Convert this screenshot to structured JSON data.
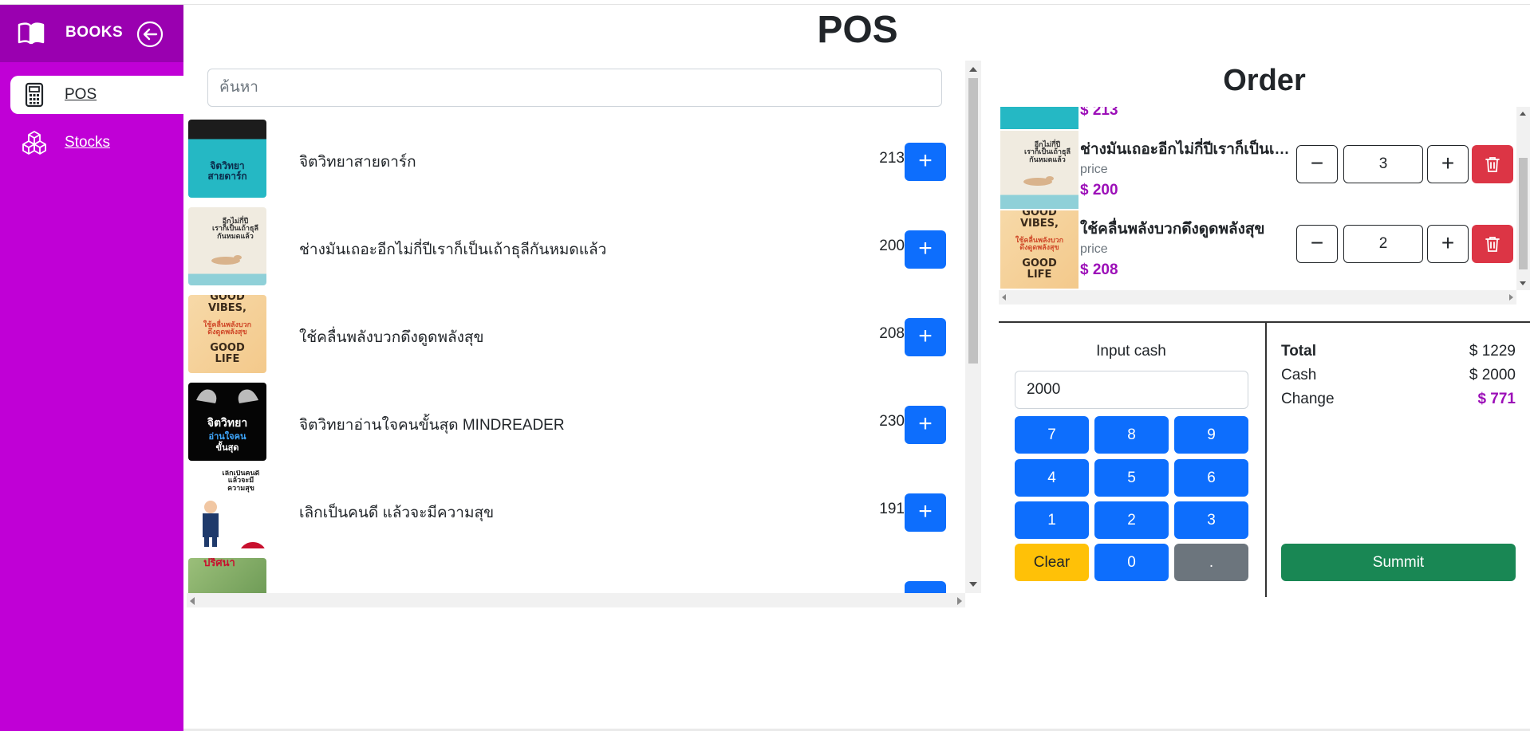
{
  "app": {
    "brand": "BOOKS",
    "page_title": "POS"
  },
  "sidebar": {
    "items": [
      {
        "label": "POS",
        "icon": "calculator-icon",
        "active": true
      },
      {
        "label": "Stocks",
        "icon": "boxes-icon",
        "active": false
      }
    ]
  },
  "search": {
    "placeholder": "ค้นหา",
    "value": ""
  },
  "products": [
    {
      "name": "จิตวิทยาสายดาร์ก",
      "price": "213",
      "add_label": "+"
    },
    {
      "name": "ช่างมันเถอะอีกไม่กี่ปีเราก็เป็นเถ้าธุลีกันหมดแล้ว",
      "price": "200",
      "add_label": "+"
    },
    {
      "name": "ใช้คลื่นพลังบวกดึงดูดพลังสุข",
      "price": "208",
      "add_label": "+"
    },
    {
      "name": "จิตวิทยาอ่านใจคนขั้นสุด MINDREADER",
      "price": "230",
      "add_label": "+"
    },
    {
      "name": "เลิกเป็นคนดี แล้วจะมีความสุข",
      "price": "191",
      "add_label": "+"
    },
    {
      "name": "",
      "price": "",
      "add_label": "+"
    }
  ],
  "covers": {
    "c1": {
      "line1": "จิตวิทยา",
      "line2": "สายดาร์ก"
    },
    "c2": {
      "line1": "อีกไม่กี่ปี",
      "line2": "เราก็เป็นเถ้าธุลี",
      "line3": "กันหมดแล้ว"
    },
    "c3": {
      "line1": "GOOD",
      "line2": "VIBES,",
      "line3": "ใช้คลื่นพลังบวก",
      "line4": "ดึงดูดพลังสุข",
      "line5": "GOOD",
      "line6": "LIFE"
    },
    "c4": {
      "line1": "จิตวิทยา",
      "line2": "อ่านใจคน",
      "line3": "ขั้นสุด"
    },
    "c5": {
      "line1": "เลิกเป็นคนดี",
      "line2": "แล้วจะมี",
      "line3": "ความสุข"
    },
    "c6": {
      "line1": "ปริศนา"
    }
  },
  "order": {
    "title": "Order",
    "price_label": "price",
    "partial_first_price": "$ 213",
    "items": [
      {
        "name": "ช่างมันเถอะอีกไม่กี่ปีเราก็เป็นเถ้าธุลีกันหมดแล้ว",
        "price": "$ 200",
        "qty": "3"
      },
      {
        "name": "ใช้คลื่นพลังบวกดึงดูดพลังสุข",
        "price": "$ 208",
        "qty": "2"
      }
    ]
  },
  "cash": {
    "label": "Input cash",
    "value": "2000",
    "keys": [
      "7",
      "8",
      "9",
      "4",
      "5",
      "6",
      "1",
      "2",
      "3",
      "Clear",
      "0",
      "."
    ]
  },
  "summary": {
    "total_label": "Total",
    "total_value": "$ 1229",
    "cash_label": "Cash",
    "cash_value": "$ 2000",
    "change_label": "Change",
    "change_value": "$ 771",
    "submit_label": "Summit"
  },
  "colors": {
    "sidebar": "#c000d6",
    "brand_bar": "#9a00b0",
    "primary": "#0d6efd",
    "danger": "#dc3545",
    "success": "#198754",
    "warning": "#ffc107",
    "accent_price": "#9c0fb8"
  }
}
